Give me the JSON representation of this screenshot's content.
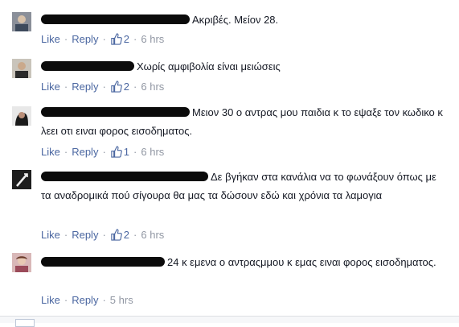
{
  "labels": {
    "like": "Like",
    "reply": "Reply",
    "sep": "·"
  },
  "comments": [
    {
      "name_redacted": true,
      "text": "Ακριβές. Μείον 28.",
      "likes": "2",
      "time": "6 hrs"
    },
    {
      "name_redacted": true,
      "text": "Χωρίς αμφιβολία είναι μειώσεις",
      "likes": "2",
      "time": "6 hrs"
    },
    {
      "name_redacted": true,
      "text": "Μειον 30 ο αντρας μου παιδια κ το εψαξε τον κωδικο κ λεει οτι ειναι φορος εισοδηματος.",
      "likes": "1",
      "time": "6 hrs"
    },
    {
      "name_redacted": true,
      "text": "Δε βγήκαν στα κανάλια να το φωνάξουν όπως με τα αναδρομικά πού σίγουρα θα μας τα δώσουν εδώ και χρόνια τα λαμογια",
      "likes": "2",
      "time": "6 hrs"
    },
    {
      "name_redacted": true,
      "text": "24 κ εμενα ο αντραςμμου κ εμας ειναι φορος εισοδηματος.",
      "likes": "",
      "time": "5 hrs"
    }
  ],
  "colors": {
    "link": "#4b67a1",
    "meta": "#9197a3",
    "text": "#141823",
    "redaction": "#0b0b0b"
  }
}
